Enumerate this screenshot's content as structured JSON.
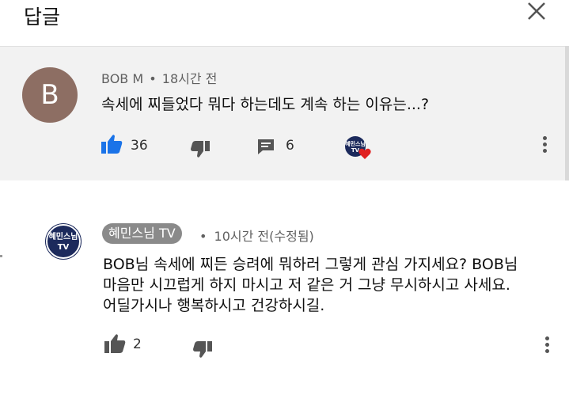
{
  "header": {
    "title": "답글",
    "close_icon": "close-icon"
  },
  "parent_comment": {
    "avatar_letter": "B",
    "author": "BOB M",
    "separator": "•",
    "time": "18시간 전",
    "text": "속세에 찌들었다 뭐다 하는데도 계속 하는 이유는...?",
    "likes": "36",
    "replies": "6",
    "heart_logo_text": "혜민스님 TV",
    "avatar_color": "#8d6e63"
  },
  "reply_comment": {
    "author": "혜민스님 TV",
    "separator": "•",
    "time": "10시간 전(수정됨)",
    "lines": [
      "BOB님 속세에 찌든 승려에 뭐하러 그렇게 관심 가지세요? BOB님",
      "마음만 시끄럽게 하지 마시고 저 같은 거 그냥 무시하시고 사세요.",
      "어딜가시나 행복하시고 건강하시길."
    ],
    "likes": "2",
    "logo_text": "혜민스님 TV"
  },
  "colors": {
    "like_blue": "#1a73e8",
    "heart_red": "#e02020",
    "logo_navy": "#1c2a5c"
  }
}
